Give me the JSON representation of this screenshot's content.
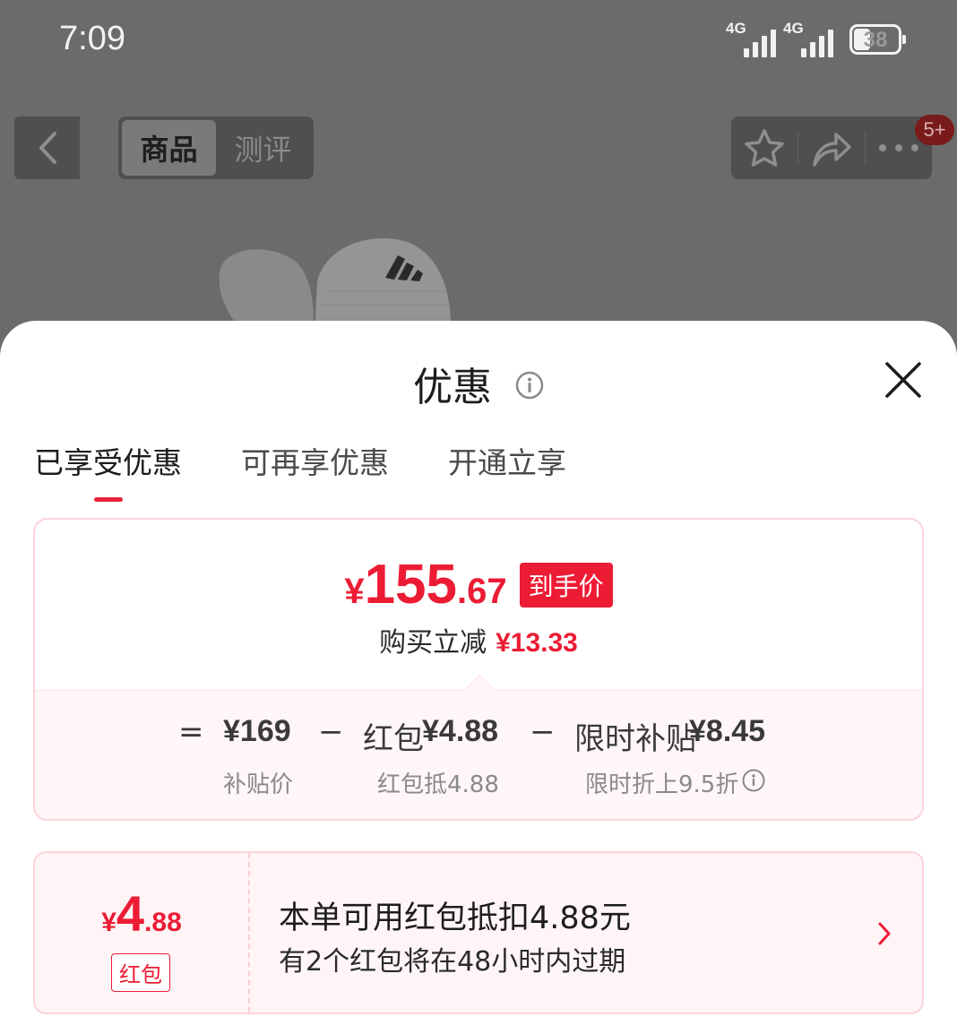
{
  "status_bar": {
    "time": "7:09",
    "signal_1": "4G",
    "signal_2": "4G",
    "battery": "38"
  },
  "nav": {
    "tabs": [
      "商品",
      "测评"
    ],
    "badge": "5+",
    "icons": [
      "back-icon",
      "star-icon",
      "share-icon",
      "more-icon"
    ]
  },
  "sheet": {
    "title": "优惠",
    "tabs": [
      "已享受优惠",
      "可再享优惠",
      "开通立享"
    ],
    "summary": {
      "currency": "¥",
      "price_int": "155",
      "price_dec": ".67",
      "price_tag": "到手价",
      "reduce_label": "购买立减",
      "reduce_amount": "¥13.33"
    },
    "calc": {
      "equals": "=",
      "base_price": "¥169",
      "minus_1": "−",
      "coupon_label": "红包",
      "coupon_amount": "¥4.88",
      "minus_2": "−",
      "subsidy_label": "限时补贴",
      "subsidy_amount": "¥8.45",
      "base_note": "补贴价",
      "coupon_note": "红包抵4.88",
      "subsidy_note": "限时折上9.5折"
    },
    "coupon": {
      "currency": "¥",
      "int": "4",
      "dec": ".88",
      "label": "红包",
      "title": "本单可用红包抵扣4.88元",
      "desc": "有2个红包将在48小时内过期"
    }
  },
  "colors": {
    "accent_red": "#ec1c34",
    "backdrop": "#6b6b6b"
  }
}
